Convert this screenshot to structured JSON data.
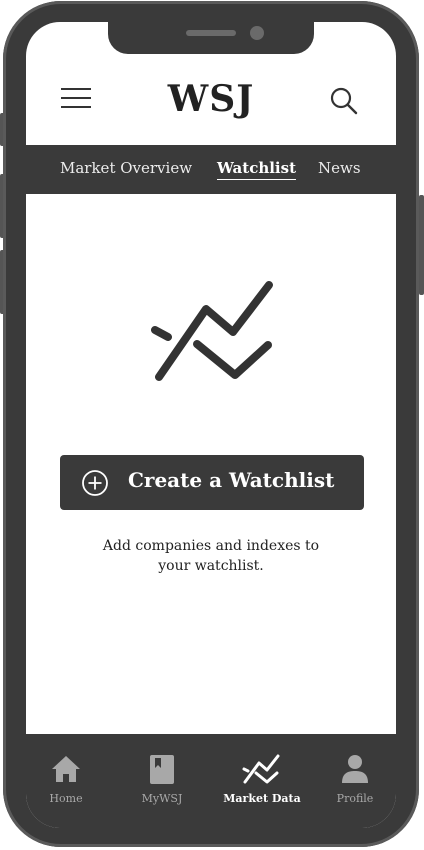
{
  "header": {
    "brand": "WSJ",
    "menu_icon": "hamburger-menu-icon",
    "search_icon": "search-icon"
  },
  "tabs": [
    {
      "label": "Market Overview",
      "active": false
    },
    {
      "label": "Watchlist",
      "active": true
    },
    {
      "label": "News",
      "active": false
    }
  ],
  "main": {
    "illustration_icon": "chart-trend-icon",
    "create_button": {
      "label": "Create a Watchlist",
      "icon": "plus-circle-icon"
    },
    "helper_text": "Add companies and indexes to your watchlist."
  },
  "bottom_nav": {
    "items": [
      {
        "label": "Home",
        "icon": "home-icon",
        "active": false
      },
      {
        "label": "MyWSJ",
        "icon": "bookmark-book-icon",
        "active": false
      },
      {
        "label": "Market Data",
        "icon": "chart-trend-icon",
        "active": true
      },
      {
        "label": "Profile",
        "icon": "user-icon",
        "active": false
      }
    ]
  },
  "colors": {
    "frame": "#3a3a3a",
    "screen": "#ffffff",
    "text_dark": "#222222",
    "nav_inactive": "#a8a8a8",
    "nav_active": "#ffffff"
  }
}
